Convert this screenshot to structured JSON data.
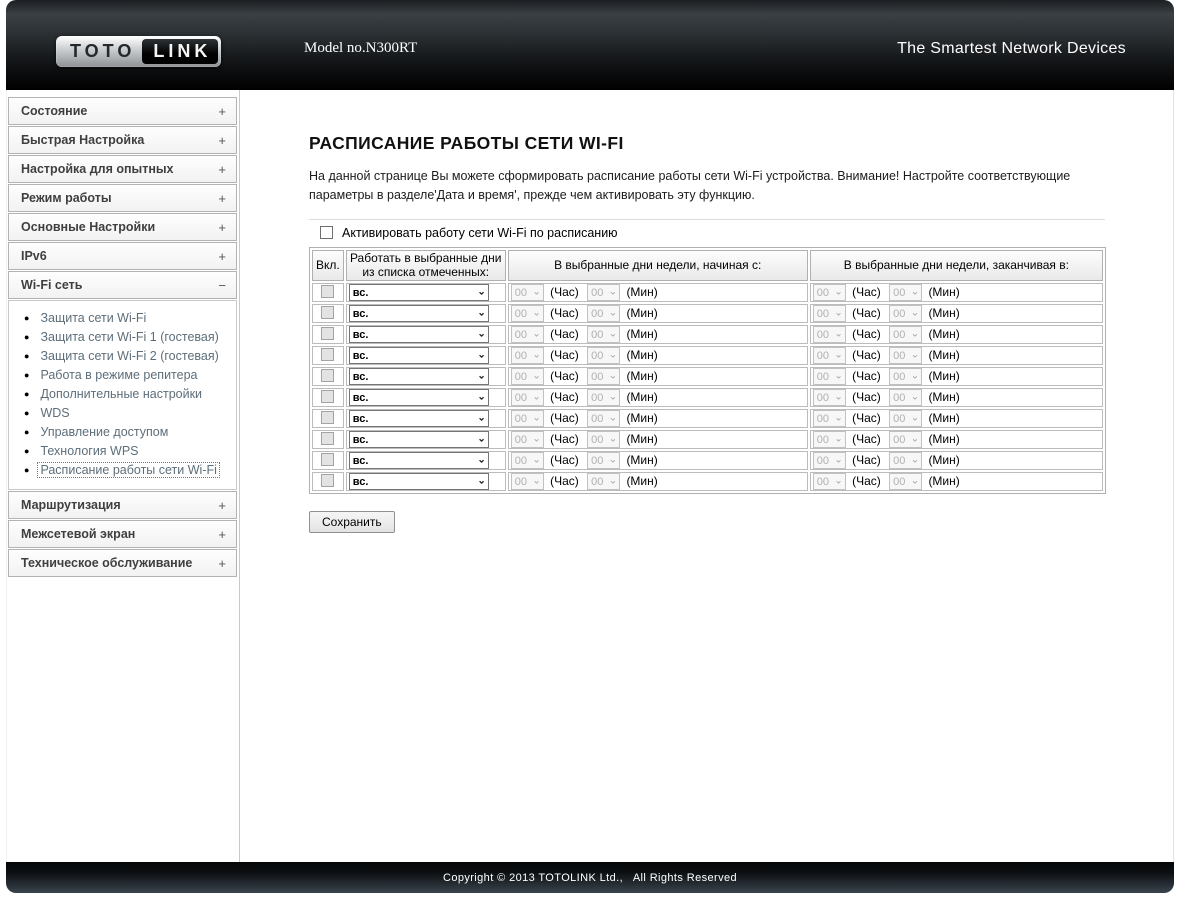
{
  "header": {
    "logo_toto": "TOTO",
    "logo_link": "LINK",
    "model": "Model no.N300RT",
    "tagline": "The Smartest Network Devices"
  },
  "icons": {
    "dropdown_chevron": "⌄",
    "bullet": "●",
    "expand": "+",
    "collapse": "−"
  },
  "colors": {
    "header_bg": "#2b3034",
    "sidebar_link": "#5d6e7a",
    "footer_bg": "#3a444d"
  },
  "sidebar": {
    "sections_top": [
      {
        "label": "Состояние",
        "toggle": "+"
      },
      {
        "label": "Быстрая Настройка",
        "toggle": "+"
      },
      {
        "label": "Настройка для опытных",
        "toggle": "+"
      },
      {
        "label": "Режим работы",
        "toggle": "+"
      },
      {
        "label": "Основные Настройки",
        "toggle": "+"
      },
      {
        "label": "IPv6",
        "toggle": "+"
      },
      {
        "label": "Wi-Fi сеть",
        "toggle": "−"
      }
    ],
    "wifi_submenu": [
      "Защита сети Wi-Fi",
      "Защита сети Wi-Fi 1 (гостевая)",
      "Защита сети Wi-Fi 2 (гостевая)",
      "Работа в режиме репитера",
      "Дополнительные настройки",
      "WDS",
      "Управление доступом",
      "Технология WPS",
      "Расписание работы сети Wi-Fi"
    ],
    "active_submenu": "Расписание работы сети Wi-Fi",
    "sections_bottom": [
      {
        "label": "Маршрутизация",
        "toggle": "+"
      },
      {
        "label": "Межсетевой экран",
        "toggle": "+"
      },
      {
        "label": "Техническое обслуживание",
        "toggle": "+"
      }
    ]
  },
  "main": {
    "title": "РАСПИСАНИЕ РАБОТЫ СЕТИ WI-FI",
    "description": "На данной странице Вы можете сформировать расписание работы сети Wi-Fi устройства. Внимание! Настройте соответствующие параметры в разделе'Дата и время', прежде чем активировать эту функцию.",
    "enable_checkbox_label": "Активировать работу сети Wi-Fi по расписанию",
    "enable_checkbox_checked": false,
    "table": {
      "headers": [
        "Вкл.",
        "Работать в выбранные дни из списка отмеченных:",
        "В выбранные дни недели, начиная с:",
        "В выбранные дни недели, заканчивая в:"
      ],
      "hour_label": "(Час)",
      "min_label": "(Мин)",
      "rows": [
        {
          "enabled": false,
          "day": "вс.",
          "start_hour": "00",
          "start_min": "00",
          "end_hour": "00",
          "end_min": "00"
        },
        {
          "enabled": false,
          "day": "вс.",
          "start_hour": "00",
          "start_min": "00",
          "end_hour": "00",
          "end_min": "00"
        },
        {
          "enabled": false,
          "day": "вс.",
          "start_hour": "00",
          "start_min": "00",
          "end_hour": "00",
          "end_min": "00"
        },
        {
          "enabled": false,
          "day": "вс.",
          "start_hour": "00",
          "start_min": "00",
          "end_hour": "00",
          "end_min": "00"
        },
        {
          "enabled": false,
          "day": "вс.",
          "start_hour": "00",
          "start_min": "00",
          "end_hour": "00",
          "end_min": "00"
        },
        {
          "enabled": false,
          "day": "вс.",
          "start_hour": "00",
          "start_min": "00",
          "end_hour": "00",
          "end_min": "00"
        },
        {
          "enabled": false,
          "day": "вс.",
          "start_hour": "00",
          "start_min": "00",
          "end_hour": "00",
          "end_min": "00"
        },
        {
          "enabled": false,
          "day": "вс.",
          "start_hour": "00",
          "start_min": "00",
          "end_hour": "00",
          "end_min": "00"
        },
        {
          "enabled": false,
          "day": "вс.",
          "start_hour": "00",
          "start_min": "00",
          "end_hour": "00",
          "end_min": "00"
        },
        {
          "enabled": false,
          "day": "вс.",
          "start_hour": "00",
          "start_min": "00",
          "end_hour": "00",
          "end_min": "00"
        }
      ]
    },
    "save_button": "Сохранить"
  },
  "footer": {
    "copyright": "Copyright © 2013 TOTOLINK Ltd.,   All Rights Reserved"
  }
}
